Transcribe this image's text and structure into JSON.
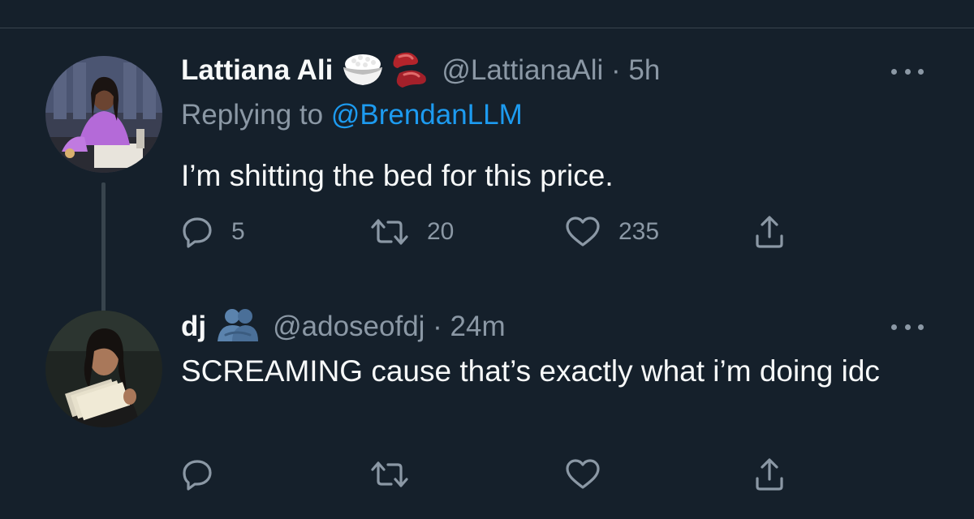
{
  "tweets": [
    {
      "display_name": "Lattiana Ali",
      "emojis": [
        "rice-bowl",
        "kidney-beans"
      ],
      "handle_time": "@LattianaAli · 5h",
      "replying_prefix": "Replying to ",
      "replying_mention": "@BrendanLLM",
      "text": "I’m shitting the bed for this price.",
      "reply_count": "5",
      "retweet_count": "20",
      "like_count": "235"
    },
    {
      "display_name": "dj",
      "emojis": [
        "people-hugging"
      ],
      "handle_time": "@adoseofdj · 24m",
      "text": "SCREAMING cause that’s exactly what i’m doing idc",
      "reply_count": "",
      "retweet_count": "",
      "like_count": ""
    }
  ],
  "colors": {
    "background": "#15202b",
    "primary_text": "#f7f9f9",
    "secondary_text": "#8b98a5",
    "accent": "#1d9bf0",
    "divider": "#38444d"
  },
  "icons": [
    "reply-icon",
    "retweet-icon",
    "like-icon",
    "share-icon",
    "more-icon"
  ]
}
